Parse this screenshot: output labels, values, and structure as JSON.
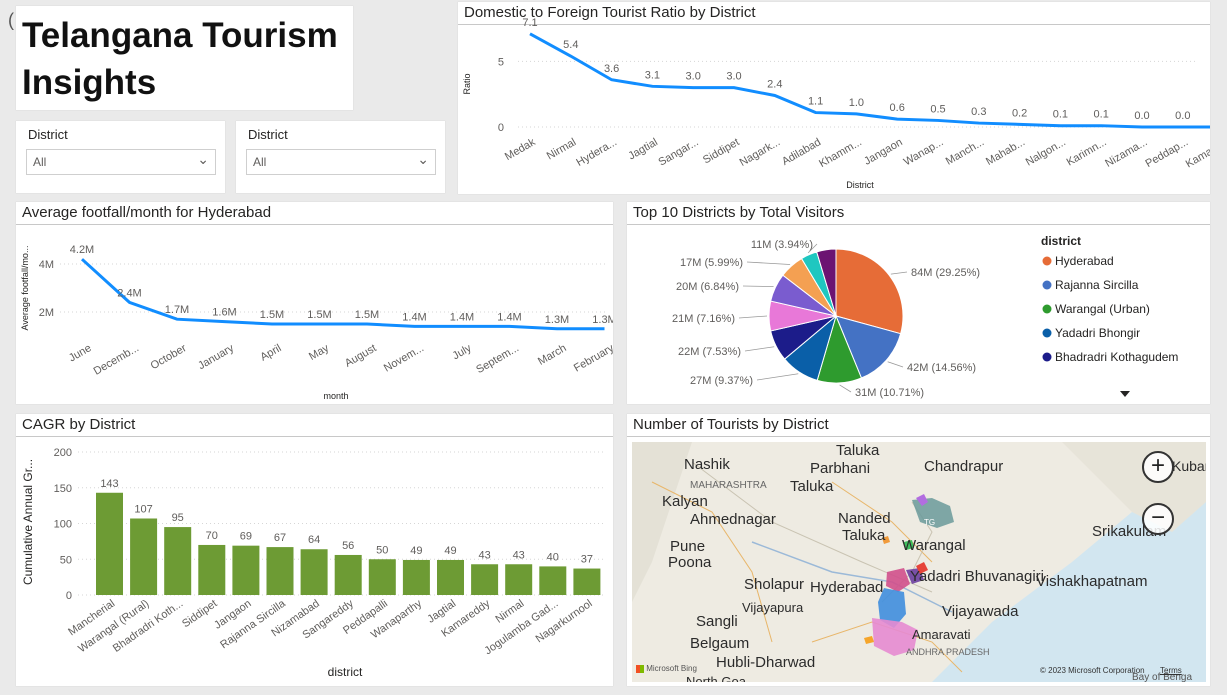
{
  "title": {
    "line1": "Telangana Tourism",
    "line2": "Insights"
  },
  "slicers": [
    {
      "label": "District",
      "value": "All"
    },
    {
      "label": "District",
      "value": "All"
    }
  ],
  "ratio_chart": {
    "title": "Domestic to Foreign Tourist Ratio by District",
    "ylabel": "Ratio",
    "xlabel": "District",
    "y_ticks": [
      "0",
      "5"
    ],
    "data_labels": [
      "7.1",
      "5.4",
      "3.6",
      "3.1",
      "3.0",
      "3.0",
      "2.4",
      "1.1",
      "1.0",
      "0.6",
      "0.5",
      "0.3",
      "0.2",
      "0.1",
      "0.1",
      "0.0",
      "0.0",
      "0.0"
    ],
    "tick_labels": [
      "Medak",
      "Nirmal",
      "Hydera...",
      "Jagtial",
      "Sangar...",
      "Siddipet",
      "Nagark...",
      "Adilabad",
      "Khamm...",
      "Jangaon",
      "Wanap...",
      "Manch...",
      "Mahab...",
      "Nalgon...",
      "Karimn...",
      "Nizama...",
      "Peddap...",
      "Kamare..."
    ]
  },
  "footfall_chart": {
    "title": "Average footfall/month for Hyderabad",
    "ylabel": "Average footfall/mo...",
    "xlabel": "month",
    "y_ticks": [
      "2M",
      "4M"
    ],
    "data_labels": [
      "4.2M",
      "2.4M",
      "1.7M",
      "1.6M",
      "1.5M",
      "1.5M",
      "1.5M",
      "1.4M",
      "1.4M",
      "1.4M",
      "1.3M",
      "1.3M"
    ],
    "tick_labels": [
      "June",
      "Decemb...",
      "October",
      "January",
      "April",
      "May",
      "August",
      "Novem...",
      "July",
      "Septem...",
      "March",
      "February"
    ]
  },
  "pie_chart": {
    "title": "Top 10 Districts by Total Visitors",
    "legend_title": "district",
    "legend": [
      "Hyderabad",
      "Rajanna Sircilla",
      "Warangal (Urban)",
      "Yadadri Bhongir",
      "Bhadradri Kothagudem"
    ],
    "slice_labels": [
      "84M (29.25%)",
      "42M (14.56%)",
      "31M (10.71%)",
      "27M (9.37%)",
      "22M (7.53%)",
      "21M (7.16%)",
      "20M (6.84%)",
      "17M (5.99%)",
      "11M (3.94%)"
    ]
  },
  "cagr_chart": {
    "title": "CAGR by District",
    "ylabel": "Cumulative Annual Gr...",
    "xlabel": "district",
    "y_ticks": [
      "0",
      "50",
      "100",
      "150",
      "200"
    ],
    "data_labels": [
      "143",
      "107",
      "95",
      "70",
      "69",
      "67",
      "64",
      "56",
      "50",
      "49",
      "49",
      "43",
      "43",
      "40",
      "37"
    ],
    "tick_labels": [
      "Mancherial",
      "Warangal (Rural)",
      "Bhadradri Koth...",
      "Siddipet",
      "Jangaon",
      "Rajanna Sircilla",
      "Nizamabad",
      "Sangareddy",
      "Peddapalli",
      "Wanaparthy",
      "Jagtial",
      "Kamareddy",
      "Nirmal",
      "Jogulamba Gad...",
      "Nagarkurnool"
    ]
  },
  "map": {
    "title": "Number of Tourists by District",
    "places": [
      "Taluka",
      "Nashik",
      "Parbhani",
      "Taluka",
      "Chandrapur",
      "MAHARASHTRA",
      "Kalyan",
      "Ahmednagar",
      "Nanded",
      "Taluka",
      "Srikakulam",
      "Pune",
      "Poona",
      "Warangal",
      "Sholapur",
      "Hyderabad",
      "Yadadri Bhuvanagiri",
      "Vishakhapatnam",
      "Vijayapura",
      "Vijayawada",
      "Sangli",
      "Belgaum",
      "Amaravati",
      "ANDHRA PRADESH",
      "Hubli-Dharwad",
      "North Goa",
      "Bay of Benga",
      "TG",
      "Kuban"
    ],
    "copyright": "© 2023 Microsoft Corporation",
    "terms": "Terms",
    "ms_logo": "Microsoft Bing",
    "zoom_in": "+",
    "zoom_out": "−"
  },
  "chart_data": [
    {
      "type": "line",
      "title": "Domestic to Foreign Tourist Ratio by District",
      "xlabel": "District",
      "ylabel": "Ratio",
      "x": [
        "Medak",
        "Nirmal",
        "Hyderabad",
        "Jagtial",
        "Sangareddy",
        "Siddipet",
        "Nagarkurnool",
        "Adilabad",
        "Khammam",
        "Jangaon",
        "Wanaparthy",
        "Mancherial",
        "Mahabubabad",
        "Nalgonda",
        "Karimnagar",
        "Nizamabad",
        "Peddapalli",
        "Kamareddy"
      ],
      "values": [
        7.1,
        5.4,
        3.6,
        3.1,
        3.0,
        3.0,
        2.4,
        1.1,
        1.0,
        0.6,
        0.5,
        0.3,
        0.2,
        0.1,
        0.1,
        0.0,
        0.0,
        0.0
      ],
      "ylim": [
        0,
        8
      ],
      "color": "#118dff"
    },
    {
      "type": "line",
      "title": "Average footfall/month for Hyderabad",
      "xlabel": "month",
      "ylabel": "Average footfall/mo...",
      "x": [
        "June",
        "December",
        "October",
        "January",
        "April",
        "May",
        "August",
        "November",
        "July",
        "September",
        "March",
        "February"
      ],
      "values": [
        4.2,
        2.4,
        1.7,
        1.6,
        1.5,
        1.5,
        1.5,
        1.4,
        1.4,
        1.4,
        1.3,
        1.3
      ],
      "unit": "M",
      "ylim": [
        0,
        5
      ],
      "color": "#118dff"
    },
    {
      "type": "pie",
      "title": "Top 10 Districts by Total Visitors",
      "categories": [
        "Hyderabad",
        "Rajanna Sircilla",
        "Warangal (Urban)",
        "Yadadri Bhongir",
        "Bhadradri Kothagudem",
        "",
        "",
        "",
        "",
        ""
      ],
      "labels": [
        "84M (29.25%)",
        "42M (14.56%)",
        "31M (10.71%)",
        "27M (9.37%)",
        "22M (7.53%)",
        "21M (7.16%)",
        "20M (6.84%)",
        "17M (5.99%)",
        "11M (3.94%)",
        ""
      ],
      "values": [
        29.25,
        14.56,
        10.71,
        9.37,
        7.53,
        7.16,
        6.84,
        5.99,
        3.94,
        4.65
      ],
      "colors": [
        "#e66c37",
        "#4472c4",
        "#2e9b2e",
        "#0a5fa8",
        "#1c1c8a",
        "#e878d8",
        "#7a5ccf",
        "#f4a052",
        "#1fc7c0",
        "#6c1372"
      ]
    },
    {
      "type": "bar",
      "title": "CAGR by District",
      "xlabel": "district",
      "ylabel": "Cumulative Annual Gr...",
      "categories": [
        "Mancherial",
        "Warangal (Rural)",
        "Bhadradri Kothagudem",
        "Siddipet",
        "Jangaon",
        "Rajanna Sircilla",
        "Nizamabad",
        "Sangareddy",
        "Peddapalli",
        "Wanaparthy",
        "Jagtial",
        "Kamareddy",
        "Nirmal",
        "Jogulamba Gadwal",
        "Nagarkurnool"
      ],
      "values": [
        143,
        107,
        95,
        70,
        69,
        67,
        64,
        56,
        50,
        49,
        49,
        43,
        43,
        40,
        37
      ],
      "ylim": [
        0,
        200
      ],
      "color": "#6d9b34"
    }
  ]
}
